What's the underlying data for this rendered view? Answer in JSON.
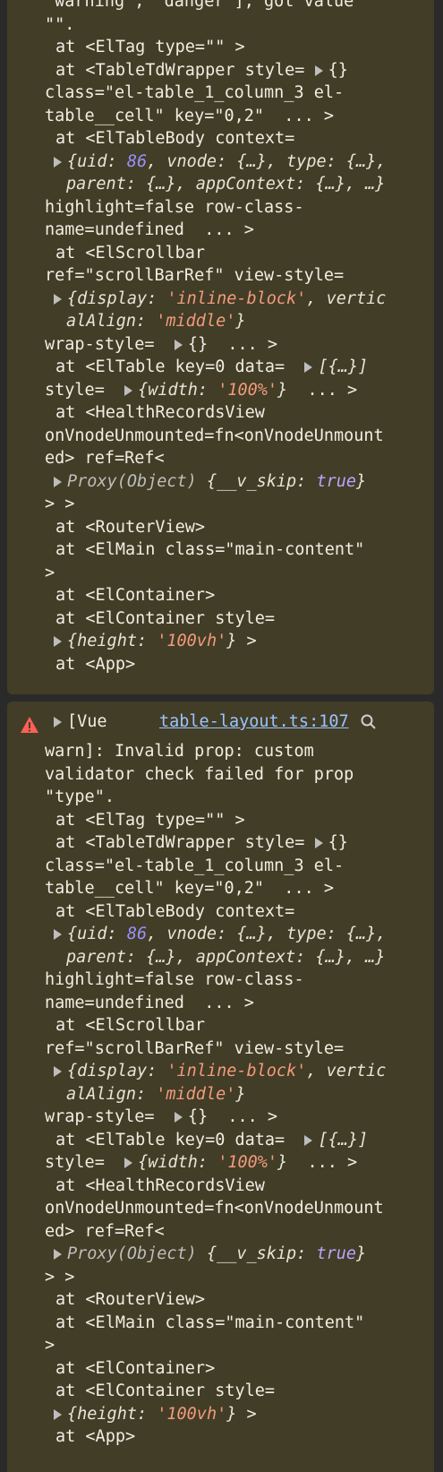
{
  "colors": {
    "bg": "#2a2a2a",
    "message_bg": "#423d26",
    "text": "#f0eee4",
    "number": "#9a90ff",
    "string": "#f29b7e",
    "keyword": "#b9a4ff",
    "link": "#9cc3ff",
    "warning": "#ff5f57"
  },
  "message1": {
    "lines": [
      "\"warning\", \"danger\"], got value",
      "\"\".",
      "at <ElTag type=\"\" >",
      "at <TableTdWrapper style=",
      "class=\"el-table_1_column_3 el-",
      "table__cell\" key=\"0,2\"  ... >",
      "at <ElTableBody context=",
      "{uid: 86, vnode: {…}, type: {…},",
      "parent: {…}, appContext: {…}, …}",
      "highlight=false row-class-",
      "name=undefined  ... >",
      "at <ElScrollbar",
      "ref=\"scrollBarRef\" view-style=",
      "{display: 'inline-block', vertic",
      "alAlign: 'middle'}",
      "wrap-style=",
      "at <ElTable key=0 data=",
      "style=",
      "at <HealthRecordsView",
      "onVnodeUnmounted=fn<onVnodeUnmount",
      "ed> ref=Ref<",
      "Proxy(Object) {__v_skip: true}",
      "> >",
      "at <RouterView>",
      "at <ElMain class=\"main-content\"",
      ">",
      "at <ElContainer>",
      "at <ElContainer style=",
      "{height: '100vh'} >",
      "at <App>"
    ]
  },
  "message2": {
    "header": "[Vue",
    "source_link": "table-layout.ts:107",
    "lines": [
      "warn]: Invalid prop: custom",
      "validator check failed for prop",
      "\"type\".",
      "at <ElTag type=\"\" >",
      "at <TableTdWrapper style=",
      "class=\"el-table_1_column_3 el-",
      "table__cell\" key=\"0,2\"  ... >",
      "at <ElTableBody context=",
      "{uid: 86, vnode: {…}, type: {…},",
      "parent: {…}, appContext: {…}, …}",
      "highlight=false row-class-",
      "name=undefined  ... >",
      "at <ElScrollbar",
      "ref=\"scrollBarRef\" view-style=",
      "{display: 'inline-block', vertic",
      "alAlign: 'middle'}",
      "wrap-style=",
      "at <ElTable key=0 data=",
      "style=",
      "at <HealthRecordsView",
      "onVnodeUnmounted=fn<onVnodeUnmount",
      "ed> ref=Ref<",
      "Proxy(Object) {__v_skip: true}",
      "> >",
      "at <RouterView>",
      "at <ElMain class=\"main-content\"",
      ">",
      "at <ElContainer>",
      "at <ElContainer style=",
      "{height: '100vh'} >",
      "at <App>"
    ]
  },
  "tokens": {
    "empty_obj": "{}",
    "ellipsis": "... >",
    "array_one": "[{…}]",
    "width_obj": "{width: '100%'}",
    "icon_warning": "warning-icon",
    "icon_search": "search-icon",
    "icon_expand": "expand-triangle-icon"
  }
}
